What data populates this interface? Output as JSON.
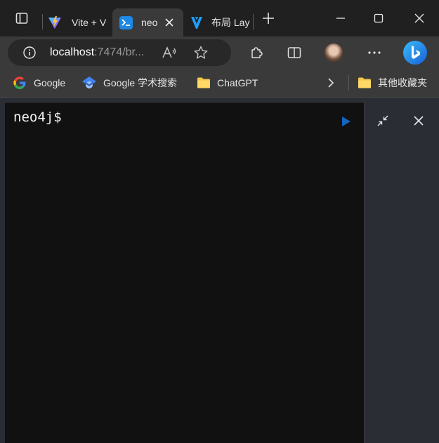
{
  "tabs": [
    {
      "title": "Vite + V",
      "icon": "vite-icon"
    },
    {
      "title": "neo",
      "icon": "terminal-icon",
      "active": true
    },
    {
      "title": "布局 Lay",
      "icon": "layui-icon"
    }
  ],
  "address": {
    "host": "localhost",
    "rest": ":7474/br..."
  },
  "bookmarks": [
    {
      "label": "Google"
    },
    {
      "label": "Google 学术搜索"
    },
    {
      "label": "ChatGPT"
    },
    {
      "label": "其他收藏夹"
    }
  ],
  "editor": {
    "prompt": "neo4j$"
  },
  "colors": {
    "accent": "#1e88e5",
    "run": "#1565c0",
    "editor_bg": "#111111",
    "panel_bg": "#2a2d34"
  }
}
